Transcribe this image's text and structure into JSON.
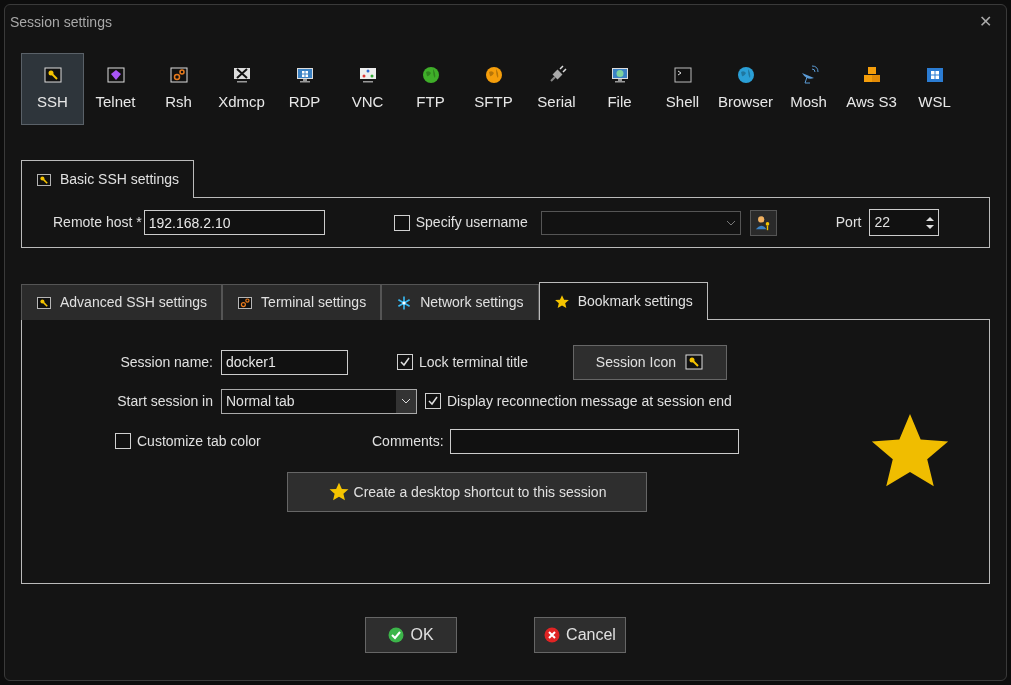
{
  "window": {
    "title": "Session settings",
    "close": "✕"
  },
  "session_types": [
    {
      "label": "SSH",
      "kind": "key",
      "selected": true
    },
    {
      "label": "Telnet",
      "kind": "gem",
      "selected": false
    },
    {
      "label": "Rsh",
      "kind": "gears",
      "selected": false
    },
    {
      "label": "Xdmcp",
      "kind": "x-monitor",
      "selected": false
    },
    {
      "label": "RDP",
      "kind": "windows-monitor",
      "selected": false
    },
    {
      "label": "VNC",
      "kind": "vnc-monitor",
      "selected": false
    },
    {
      "label": "FTP",
      "kind": "globe-green",
      "selected": false
    },
    {
      "label": "SFTP",
      "kind": "globe-orange",
      "selected": false
    },
    {
      "label": "Serial",
      "kind": "plug",
      "selected": false
    },
    {
      "label": "File",
      "kind": "globe-monitor",
      "selected": false
    },
    {
      "label": "Shell",
      "kind": "terminal",
      "selected": false
    },
    {
      "label": "Browser",
      "kind": "globe-blue",
      "selected": false
    },
    {
      "label": "Mosh",
      "kind": "dish",
      "selected": false
    },
    {
      "label": "Aws S3",
      "kind": "boxes",
      "selected": false
    },
    {
      "label": "WSL",
      "kind": "windows",
      "selected": false
    }
  ],
  "basic_tab": {
    "label": "Basic SSH settings"
  },
  "basic": {
    "remote_host_label": "Remote host *",
    "remote_host": "192.168.2.10",
    "specify_username": {
      "label": "Specify username",
      "checked": false
    },
    "port_label": "Port",
    "port": "22"
  },
  "tabs": [
    {
      "label": "Advanced SSH settings",
      "kind": "key",
      "selected": false
    },
    {
      "label": "Terminal settings",
      "kind": "gears",
      "selected": false
    },
    {
      "label": "Network settings",
      "kind": "network",
      "selected": false
    },
    {
      "label": "Bookmark settings",
      "kind": "star",
      "selected": true
    }
  ],
  "bookmark": {
    "session_name_label": "Session name:",
    "session_name": "docker1",
    "lock_title": {
      "label": "Lock terminal title",
      "checked": true
    },
    "session_icon_button": "Session Icon",
    "start_in_label": "Start session in",
    "start_in": "Normal tab",
    "reconnect_msg": {
      "label": "Display reconnection message at session end",
      "checked": true
    },
    "custom_color": {
      "label": "Customize tab color",
      "checked": false
    },
    "comments_label": "Comments:",
    "shortcut_button": "Create a desktop shortcut to this session"
  },
  "buttons": [
    {
      "label": "OK",
      "kind": "ok"
    },
    {
      "label": "Cancel",
      "kind": "cancel"
    }
  ]
}
